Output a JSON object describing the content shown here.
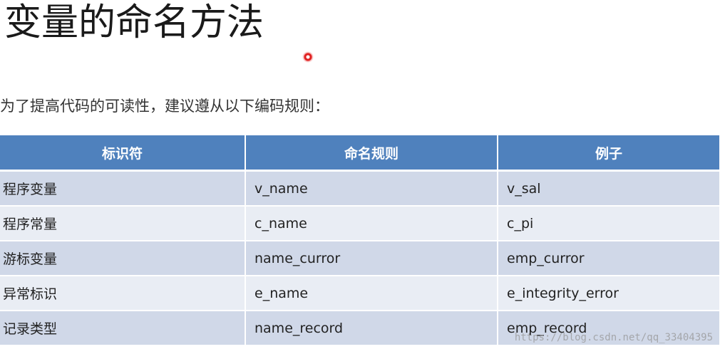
{
  "slide": {
    "title": "变量的命名方法",
    "intro": "为了提高代码的可读性，建议遵从以下编码规则："
  },
  "table": {
    "headers": [
      "标识符",
      "命名规则",
      "例子"
    ],
    "rows": [
      [
        "程序变量",
        "v_name",
        "v_sal"
      ],
      [
        "程序常量",
        "c_name",
        "c_pi"
      ],
      [
        "游标变量",
        "name_curror",
        "emp_curror"
      ],
      [
        "异常标识",
        "e_name",
        "e_integrity_error"
      ],
      [
        "记录类型",
        "name_record",
        "emp_record"
      ]
    ]
  },
  "watermark": "https://blog.csdn.net/qq_33404395",
  "colors": {
    "header_bg": "#4f81bd",
    "row_odd_bg": "#d0d8e8",
    "row_even_bg": "#e9edf4",
    "laser_pointer": "#e02020"
  }
}
